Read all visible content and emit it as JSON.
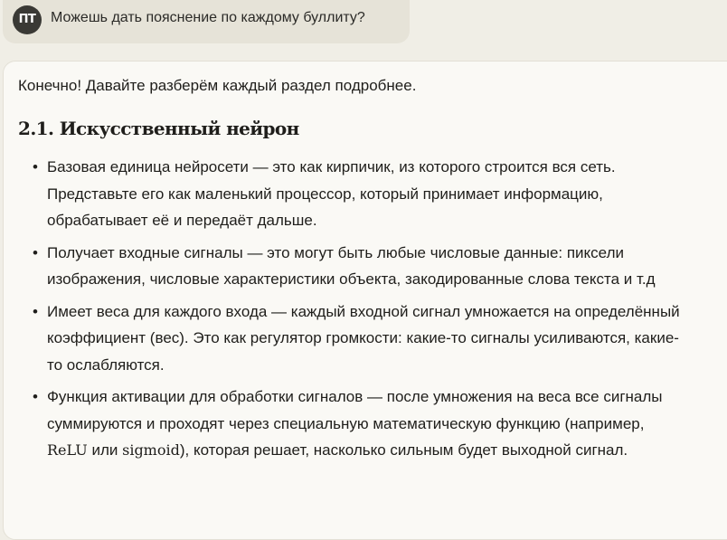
{
  "user": {
    "avatar_initials": "ПТ",
    "message": "Можешь дать пояснение по каждому буллиту?"
  },
  "assistant": {
    "intro": "Конечно! Давайте разберём каждый раздел подробнее.",
    "heading": "2.1. Искусственный нейрон",
    "bullets": [
      {
        "text": "Базовая единица нейросети — это как кирпичик, из которого строится вся сеть. Представьте его как маленький процессор, который принимает информацию, обрабатывает её и передаёт дальше."
      },
      {
        "text": "Получает входные сигналы — это могут быть любые числовые данные: пиксели изображения, числовые характеристики объекта, закодированные слова текста и т.д"
      },
      {
        "text": "Имеет веса для каждого входа — каждый входной сигнал умножается на определённый коэффициент (вес). Это как регулятор громкости: какие-то сигналы усиливаются, какие-то ослабляются."
      },
      {
        "text_before": "Функция активации для обработки сигналов — после умножения на веса все сигналы суммируются и проходят через специальную математическую функцию (например, ",
        "term1": "ReLU",
        "text_mid": " или ",
        "term2": "sigmoid",
        "text_after": "), которая решает, насколько сильным будет выходной сигнал."
      }
    ]
  }
}
